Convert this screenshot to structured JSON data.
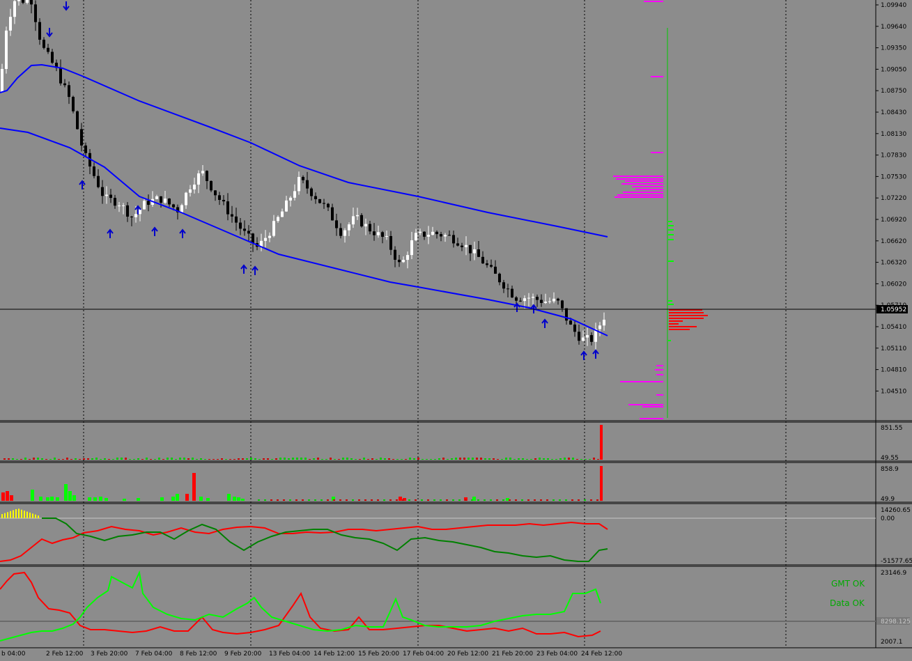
{
  "main_panel": {
    "price_labels": [
      "1.09940",
      "1.09640",
      "1.09350",
      "1.09050",
      "1.08750",
      "1.08430",
      "1.08130",
      "1.07830",
      "1.07530",
      "1.07220",
      "1.06920",
      "1.06620",
      "1.06320",
      "1.06020",
      "1.05710",
      "1.05410",
      "1.05110",
      "1.04810",
      "1.04510"
    ],
    "current_price": "1.05952"
  },
  "time_labels": [
    "b 04:00",
    "2 Feb 12:00",
    "3 Feb 20:00",
    "7 Feb 04:00",
    "8 Feb 12:00",
    "9 Feb 20:00",
    "13 Feb 04:00",
    "14 Feb 12:00",
    "15 Feb 20:00",
    "17 Feb 04:00",
    "20 Feb 12:00",
    "21 Feb 20:00",
    "23 Feb 04:00",
    "24 Feb 12:00"
  ],
  "volume_panel_1": {
    "top_label": "851.55",
    "bottom_label": "49.55"
  },
  "volume_panel_2": {
    "top_label": "858.9",
    "bottom_label": "49.9"
  },
  "oscillator_panel": {
    "top_label": "14260.65",
    "zero_label": "0.00",
    "bottom_label": "-51577.65"
  },
  "bottom_panel": {
    "top_label": "23146.9",
    "mid_label": "8298.125",
    "bottom_label": "2007.1"
  },
  "status": {
    "gmt": "GMT OK",
    "data": "Data OK"
  },
  "colors": {
    "background": "#8c8c8c",
    "bull_candle": "#ffffff",
    "bear_candle": "#000000",
    "envelope": "#0000ff",
    "arrow": "#0000cc",
    "profile_magenta": "#ff00ff",
    "profile_red": "#ff0000",
    "profile_green": "#00ff00",
    "osc_red": "#ff0000",
    "osc_green": "#008000",
    "bright_green": "#00ff00"
  }
}
